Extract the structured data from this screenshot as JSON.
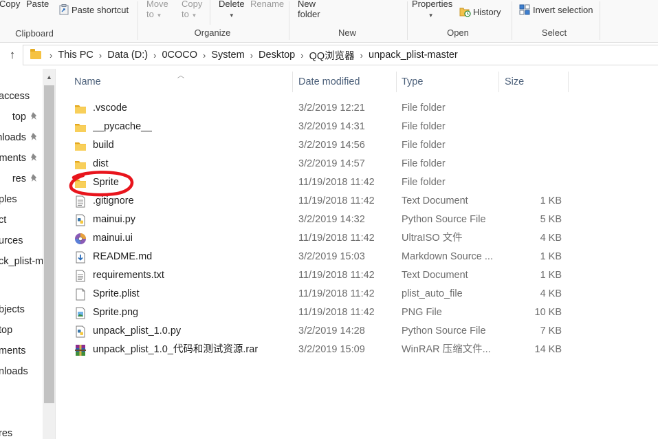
{
  "ribbon": {
    "clipboard": {
      "label": "Clipboard",
      "copy": "Copy",
      "paste": "Paste",
      "paste_shortcut": "Paste shortcut"
    },
    "organize": {
      "label": "Organize",
      "move_to": "Move",
      "move_to_line2": "to",
      "copy_to": "Copy",
      "copy_to_line2": "to",
      "delete": "Delete",
      "rename": "Rename"
    },
    "new": {
      "label": "New",
      "new_folder": "New",
      "new_folder_line2": "folder"
    },
    "open": {
      "label": "Open",
      "properties": "Properties",
      "history": "History"
    },
    "select": {
      "label": "Select",
      "invert_selection": "Invert selection"
    }
  },
  "address": {
    "breadcrumbs": [
      "This PC",
      "Data  (D:)",
      "0COCO",
      "System",
      "Desktop",
      "QQ浏览器",
      "unpack_plist-master"
    ]
  },
  "nav": {
    "items": [
      {
        "label": "access",
        "pinned": false
      },
      {
        "label": "top",
        "pinned": true
      },
      {
        "label": "nloads",
        "pinned": true
      },
      {
        "label": "ments",
        "pinned": true
      },
      {
        "label": "res",
        "pinned": true
      },
      {
        "label": "ples",
        "pinned": false
      },
      {
        "label": "ct",
        "pinned": false
      },
      {
        "label": "urces",
        "pinned": false
      },
      {
        "label": "ck_plist-m",
        "pinned": false
      },
      {
        "label": "",
        "pinned": false
      },
      {
        "label": "bjects",
        "pinned": false
      },
      {
        "label": "top",
        "pinned": false
      },
      {
        "label": "ments",
        "pinned": false
      },
      {
        "label": "nloads",
        "pinned": false
      },
      {
        "label": "",
        "pinned": false
      },
      {
        "label": "",
        "pinned": false
      },
      {
        "label": "res",
        "pinned": false
      }
    ]
  },
  "columns": {
    "name": "Name",
    "date": "Date modified",
    "type": "Type",
    "size": "Size"
  },
  "files": [
    {
      "name": ".vscode",
      "date": "3/2/2019 12:21",
      "type": "File folder",
      "size": "",
      "icon": "folder-icon"
    },
    {
      "name": "__pycache__",
      "date": "3/2/2019 14:31",
      "type": "File folder",
      "size": "",
      "icon": "folder-icon"
    },
    {
      "name": "build",
      "date": "3/2/2019 14:56",
      "type": "File folder",
      "size": "",
      "icon": "folder-icon"
    },
    {
      "name": "dist",
      "date": "3/2/2019 14:57",
      "type": "File folder",
      "size": "",
      "icon": "folder-icon"
    },
    {
      "name": "Sprite",
      "date": "11/19/2018 11:42",
      "type": "File folder",
      "size": "",
      "icon": "folder-icon"
    },
    {
      "name": ".gitignore",
      "date": "11/19/2018 11:42",
      "type": "Text Document",
      "size": "1 KB",
      "icon": "text-document-icon"
    },
    {
      "name": "mainui.py",
      "date": "3/2/2019 14:32",
      "type": "Python Source File",
      "size": "5 KB",
      "icon": "python-file-icon"
    },
    {
      "name": "mainui.ui",
      "date": "11/19/2018 11:42",
      "type": "UltraISO 文件",
      "size": "4 KB",
      "icon": "ultraiso-disc-icon"
    },
    {
      "name": "README.md",
      "date": "3/2/2019 15:03",
      "type": "Markdown Source ...",
      "size": "1 KB",
      "icon": "markdown-file-icon"
    },
    {
      "name": "requirements.txt",
      "date": "11/19/2018 11:42",
      "type": "Text Document",
      "size": "1 KB",
      "icon": "text-document-icon"
    },
    {
      "name": "Sprite.plist",
      "date": "11/19/2018 11:42",
      "type": "plist_auto_file",
      "size": "4 KB",
      "icon": "blank-file-icon"
    },
    {
      "name": "Sprite.png",
      "date": "11/19/2018 11:42",
      "type": "PNG File",
      "size": "10 KB",
      "icon": "image-file-icon"
    },
    {
      "name": "unpack_plist_1.0.py",
      "date": "3/2/2019 14:28",
      "type": "Python Source File",
      "size": "7 KB",
      "icon": "python-file-icon"
    },
    {
      "name": "unpack_plist_1.0_代码和测试资源.rar",
      "date": "3/2/2019 15:09",
      "type": "WinRAR 压缩文件...",
      "size": "14 KB",
      "icon": "winrar-archive-icon"
    }
  ],
  "annotation": {
    "color": "#e8141c"
  }
}
